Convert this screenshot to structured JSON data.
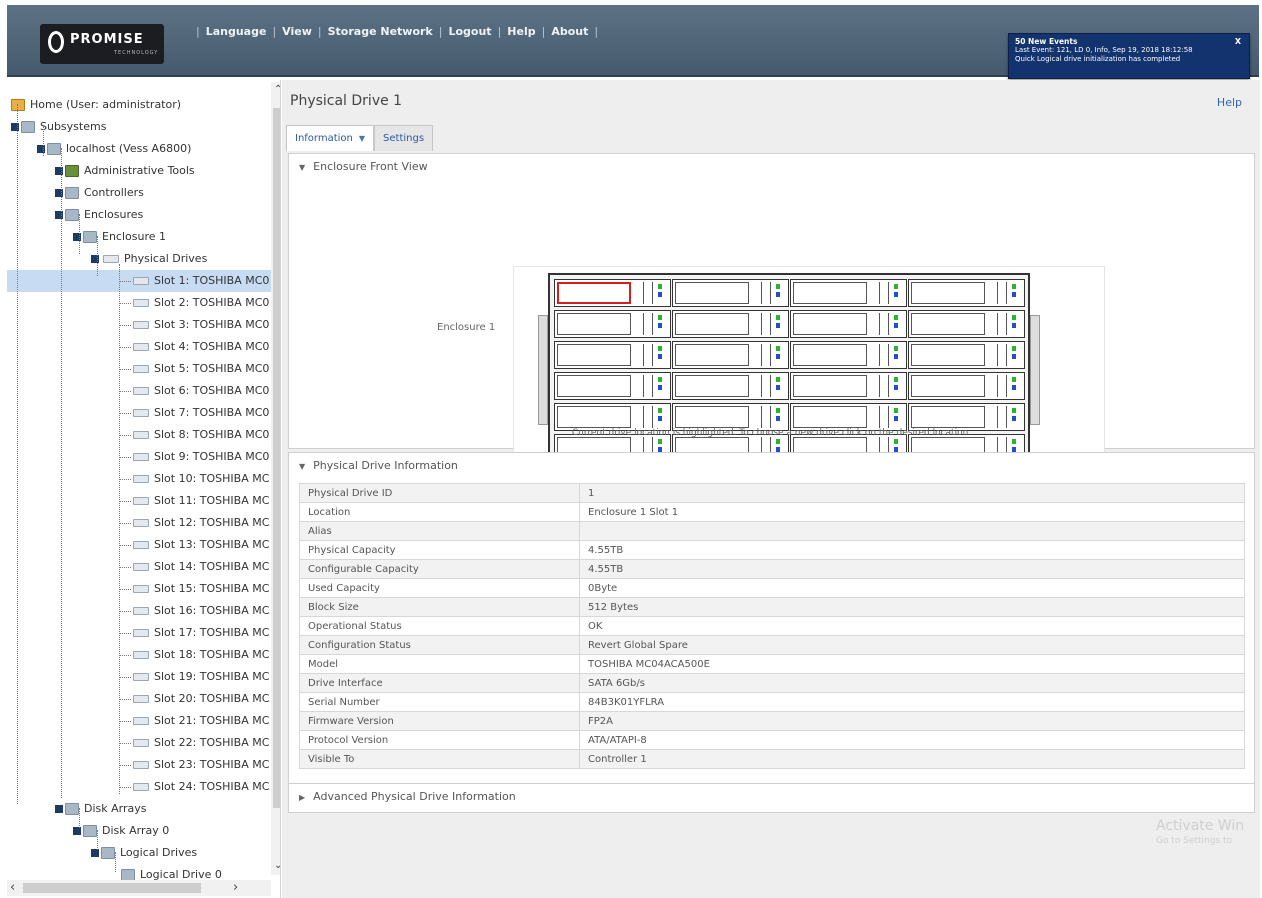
{
  "header": {
    "logo_text": "PROMISE",
    "logo_sub": "TECHNOLOGY",
    "nav": [
      "Language",
      "View",
      "Storage Network",
      "Logout",
      "Help",
      "About"
    ],
    "events": {
      "title": "50 New Events",
      "line1": "Last Event: 121, LD 0, Info, Sep 19, 2018 18:12:58",
      "line2": "Quick Logical drive initialization has completed",
      "close": "X"
    }
  },
  "tree": {
    "home": "Home (User: administrator)",
    "subsystems": "Subsystems",
    "localhost": "localhost (Vess A6800)",
    "admin_tools": "Administrative Tools",
    "controllers": "Controllers",
    "enclosures": "Enclosures",
    "enclosure1": "Enclosure 1",
    "physical_drives": "Physical Drives",
    "slots": [
      "Slot 1: TOSHIBA MC0",
      "Slot 2: TOSHIBA MC0",
      "Slot 3: TOSHIBA MC0",
      "Slot 4: TOSHIBA MC0",
      "Slot 5: TOSHIBA MC0",
      "Slot 6: TOSHIBA MC0",
      "Slot 7: TOSHIBA MC0",
      "Slot 8: TOSHIBA MC0",
      "Slot 9: TOSHIBA MC0",
      "Slot 10: TOSHIBA MC",
      "Slot 11: TOSHIBA MC",
      "Slot 12: TOSHIBA MC",
      "Slot 13: TOSHIBA MC",
      "Slot 14: TOSHIBA MC",
      "Slot 15: TOSHIBA MC",
      "Slot 16: TOSHIBA MC",
      "Slot 17: TOSHIBA MC",
      "Slot 18: TOSHIBA MC",
      "Slot 19: TOSHIBA MC",
      "Slot 20: TOSHIBA MC",
      "Slot 21: TOSHIBA MC",
      "Slot 22: TOSHIBA MC",
      "Slot 23: TOSHIBA MC",
      "Slot 24: TOSHIBA MC"
    ],
    "disk_arrays": "Disk Arrays",
    "disk_array0": "Disk Array 0",
    "logical_drives": "Logical Drives",
    "logical_drive0": "Logical Drive 0"
  },
  "main": {
    "title": "Physical Drive 1",
    "help": "Help",
    "tabs": {
      "information": "Information",
      "settings": "Settings"
    },
    "front_view": {
      "heading": "Enclosure Front View",
      "enclosure_label": "Enclosure 1",
      "hint": "Current drive location is highlighted. To choose a new drive click on the desired location."
    },
    "info": {
      "heading": "Physical Drive Information",
      "rows": [
        [
          "Physical Drive ID",
          "1"
        ],
        [
          "Location",
          "Enclosure 1 Slot 1"
        ],
        [
          "Alias",
          ""
        ],
        [
          "Physical Capacity",
          "4.55TB"
        ],
        [
          "Configurable Capacity",
          "4.55TB"
        ],
        [
          "Used Capacity",
          "0Byte"
        ],
        [
          "Block Size",
          "512 Bytes"
        ],
        [
          "Operational Status",
          "OK"
        ],
        [
          "Configuration Status",
          "Revert Global Spare"
        ],
        [
          "Model",
          "TOSHIBA MC04ACA500E"
        ],
        [
          "Drive Interface",
          "SATA 6Gb/s"
        ],
        [
          "Serial Number",
          "84B3K01YFLRA"
        ],
        [
          "Firmware Version",
          "FP2A"
        ],
        [
          "Protocol Version",
          "ATA/ATAPI-8"
        ],
        [
          "Visible To",
          "Controller 1"
        ]
      ]
    },
    "advanced": {
      "heading": "Advanced Physical Drive Information"
    }
  },
  "watermark": {
    "line1": "Activate Win",
    "line2": "Go to Settings to"
  }
}
